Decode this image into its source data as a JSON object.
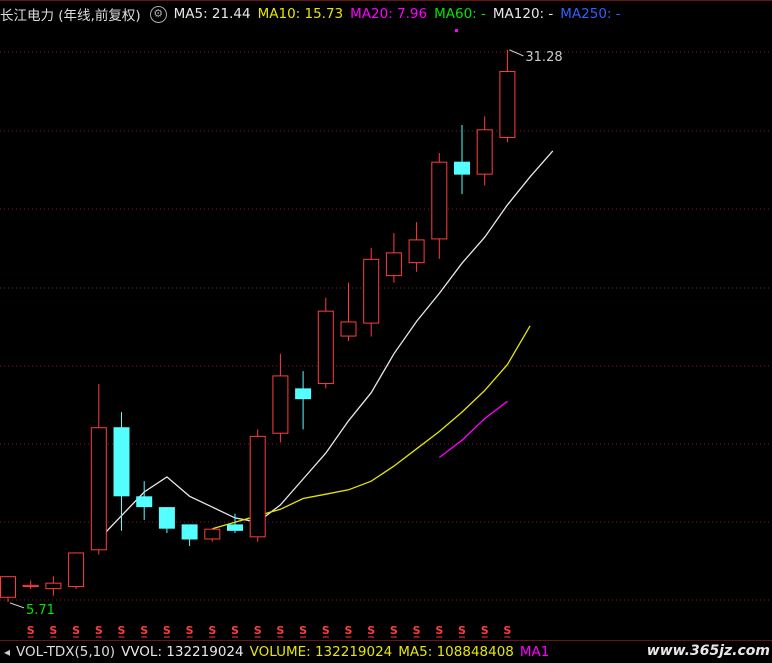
{
  "header": {
    "title": "长江电力 (年线,前复权)",
    "ma5": "MA5: 21.44",
    "ma10": "MA10: 15.73",
    "ma20": "MA20: 7.96",
    "ma60": "MA60: -",
    "ma120": "MA120: -",
    "ma250": "MA250: -"
  },
  "footer": {
    "indicator": "VOL-TDX(5,10)",
    "vvol": "VVOL: 132219024",
    "volume": "VOLUME: 132219024",
    "ma5": "MA5: 108848408",
    "ma10": "MA1"
  },
  "watermark": "www.365jz.com",
  "colors": {
    "up": "#ff3d3d",
    "down": "#54ffff",
    "ma5": "#e8e8e8",
    "ma10": "#e6e600",
    "ma20": "#ff00ff",
    "ma60": "#00e600",
    "ma250": "#3060ff",
    "grid": "#7a1e1e"
  },
  "chart_data": {
    "type": "candlestick",
    "title": "长江电力 (年线,前复权)",
    "ylim": [
      4.5,
      32.2
    ],
    "annotations": {
      "high": "31.28",
      "low": "5.71"
    },
    "candles": [
      {
        "o": 5.9,
        "c": 6.9,
        "h": 6.9,
        "l": 5.71
      },
      {
        "o": 6.4,
        "c": 6.5,
        "h": 6.7,
        "l": 6.3
      },
      {
        "o": 6.3,
        "c": 6.6,
        "h": 6.9,
        "l": 6.0
      },
      {
        "o": 6.4,
        "c": 8.0,
        "h": 8.0,
        "l": 6.3
      },
      {
        "o": 8.1,
        "c": 13.8,
        "h": 15.8,
        "l": 7.9
      },
      {
        "o": 13.8,
        "c": 10.6,
        "h": 14.5,
        "l": 9.0
      },
      {
        "o": 10.6,
        "c": 10.1,
        "h": 11.3,
        "l": 9.5
      },
      {
        "o": 10.1,
        "c": 9.1,
        "h": 10.1,
        "l": 8.9
      },
      {
        "o": 9.3,
        "c": 8.6,
        "h": 9.3,
        "l": 8.3
      },
      {
        "o": 8.6,
        "c": 9.1,
        "h": 9.1,
        "l": 8.5
      },
      {
        "o": 9.3,
        "c": 9.0,
        "h": 9.8,
        "l": 8.9
      },
      {
        "o": 8.7,
        "c": 13.4,
        "h": 13.7,
        "l": 8.5
      },
      {
        "o": 13.5,
        "c": 16.2,
        "h": 17.2,
        "l": 13.1
      },
      {
        "o": 15.6,
        "c": 15.1,
        "h": 16.4,
        "l": 13.7
      },
      {
        "o": 15.8,
        "c": 19.2,
        "h": 19.8,
        "l": 15.6
      },
      {
        "o": 18.0,
        "c": 18.7,
        "h": 20.5,
        "l": 17.8
      },
      {
        "o": 18.6,
        "c": 21.6,
        "h": 22.1,
        "l": 18.0
      },
      {
        "o": 20.8,
        "c": 21.9,
        "h": 22.8,
        "l": 20.5
      },
      {
        "o": 21.4,
        "c": 22.5,
        "h": 23.3,
        "l": 21.0
      },
      {
        "o": 22.5,
        "c": 26.1,
        "h": 26.5,
        "l": 21.6
      },
      {
        "o": 26.1,
        "c": 25.5,
        "h": 27.8,
        "l": 24.6
      },
      {
        "o": 25.5,
        "c": 27.6,
        "h": 28.2,
        "l": 25.0
      },
      {
        "o": 27.2,
        "c": 30.3,
        "h": 31.28,
        "l": 27.0
      }
    ],
    "ma": [
      {
        "name": "MA5",
        "color": "#e8e8e8",
        "start": 4,
        "values": [
          8.6,
          9.7,
          10.8,
          11.5,
          10.6,
          10.1,
          9.6,
          9.4,
          10.2,
          11.4,
          12.6,
          14.1,
          15.4,
          17.2,
          18.7,
          20.0,
          21.4,
          22.6,
          24.1,
          25.4,
          26.6
        ]
      },
      {
        "name": "MA10",
        "color": "#e6e600",
        "start": 9,
        "values": [
          9.1,
          9.4,
          9.7,
          10.0,
          10.5,
          10.7,
          10.9,
          11.3,
          12.0,
          12.8,
          13.6,
          14.5,
          15.5,
          16.7,
          18.5
        ]
      },
      {
        "name": "MA20",
        "color": "#ff00ff",
        "start": 19,
        "values": [
          12.4,
          13.2,
          14.2,
          15.0
        ]
      }
    ],
    "s_markers": 22
  }
}
